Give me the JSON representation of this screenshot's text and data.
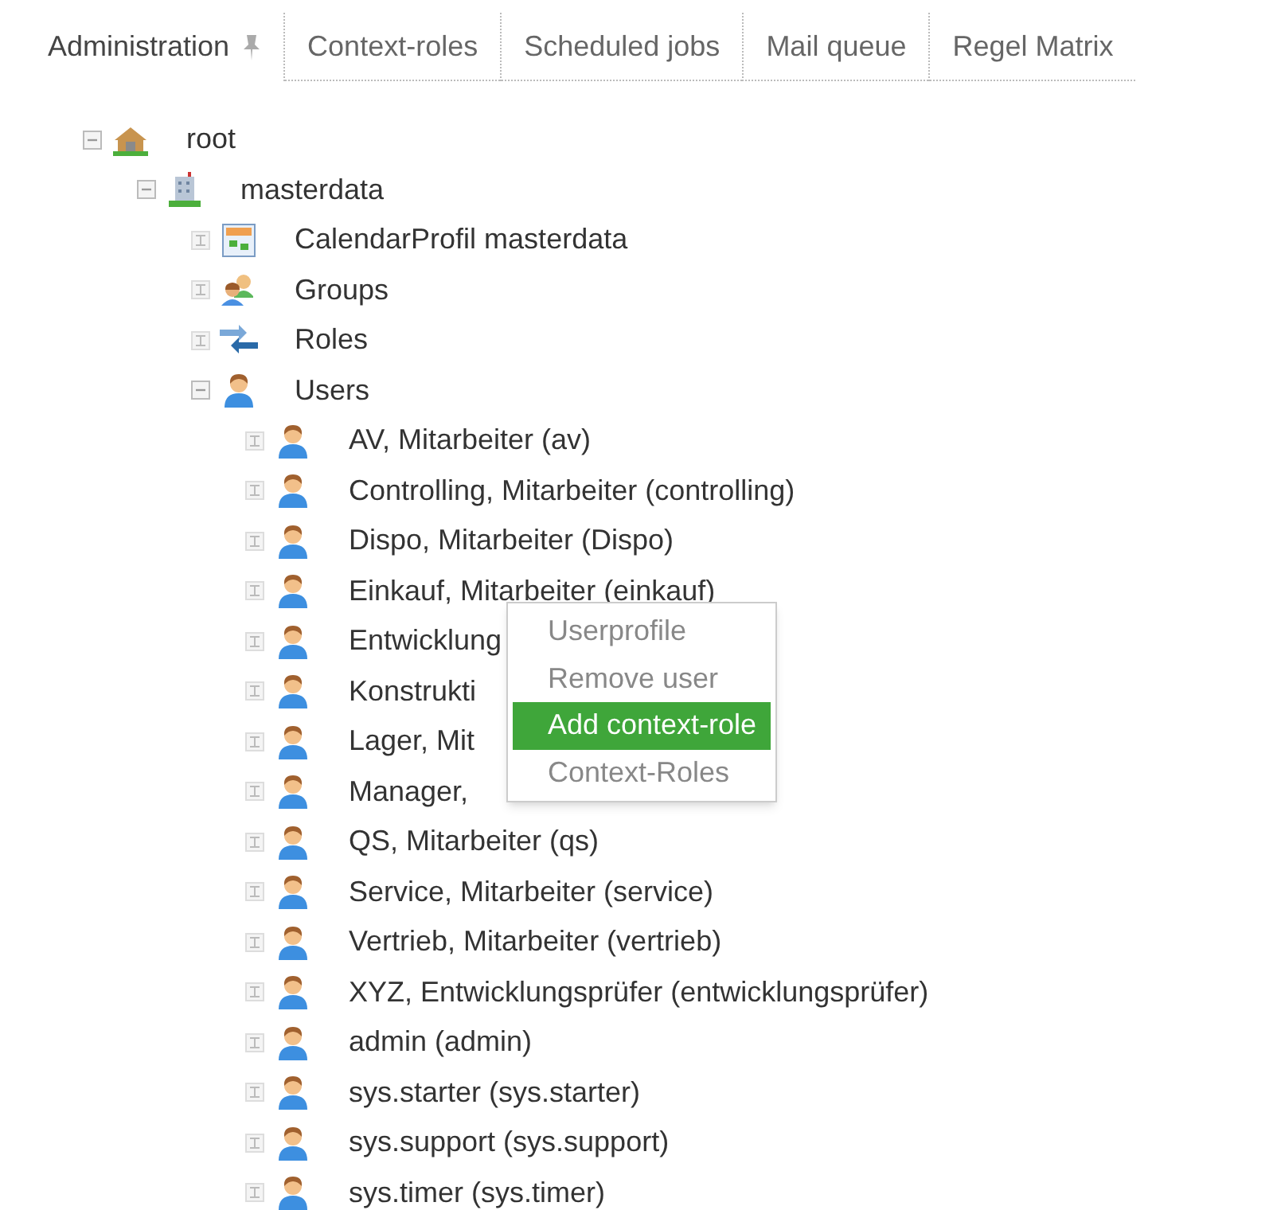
{
  "tabs": [
    {
      "label": "Administration",
      "selected": true,
      "pinned": true
    },
    {
      "label": "Context-roles",
      "selected": false,
      "pinned": false
    },
    {
      "label": "Scheduled jobs",
      "selected": false,
      "pinned": false
    },
    {
      "label": "Mail queue",
      "selected": false,
      "pinned": false
    },
    {
      "label": "Regel Matrix",
      "selected": false,
      "pinned": false
    }
  ],
  "tree": [
    {
      "label": "root",
      "kind": "home",
      "expanded": true,
      "children": [
        {
          "label": "masterdata",
          "kind": "building",
          "expanded": true,
          "children": [
            {
              "label": "CalendarProfil masterdata",
              "kind": "calendar",
              "expanded": false
            },
            {
              "label": "Groups",
              "kind": "group",
              "expanded": false
            },
            {
              "label": "Roles",
              "kind": "roles",
              "expanded": false
            },
            {
              "label": "Users",
              "kind": "user",
              "expanded": true,
              "children": [
                {
                  "label": "AV, Mitarbeiter (av)",
                  "kind": "user",
                  "expanded": false
                },
                {
                  "label": "Controlling, Mitarbeiter (controlling)",
                  "kind": "user",
                  "expanded": false
                },
                {
                  "label": "Dispo, Mitarbeiter (Dispo)",
                  "kind": "user",
                  "expanded": false
                },
                {
                  "label": "Einkauf, Mitarbeiter (einkauf)",
                  "kind": "user",
                  "expanded": false
                },
                {
                  "label": "Entwicklung",
                  "kind": "user",
                  "expanded": false
                },
                {
                  "label": "Konstrukti",
                  "kind": "user",
                  "expanded": false
                },
                {
                  "label": "Lager, Mit",
                  "kind": "user",
                  "expanded": false
                },
                {
                  "label": "Manager,",
                  "kind": "user",
                  "expanded": false
                },
                {
                  "label": "QS, Mitarbeiter (qs)",
                  "kind": "user",
                  "expanded": false
                },
                {
                  "label": "Service, Mitarbeiter (service)",
                  "kind": "user",
                  "expanded": false
                },
                {
                  "label": "Vertrieb, Mitarbeiter (vertrieb)",
                  "kind": "user",
                  "expanded": false
                },
                {
                  "label": "XYZ, Entwicklungsprüfer (entwicklungsprüfer)",
                  "kind": "user",
                  "expanded": false
                },
                {
                  "label": "admin (admin)",
                  "kind": "user",
                  "expanded": false
                },
                {
                  "label": "sys.starter (sys.starter)",
                  "kind": "user",
                  "expanded": false
                },
                {
                  "label": "sys.support (sys.support)",
                  "kind": "user",
                  "expanded": false
                },
                {
                  "label": "sys.timer (sys.timer)",
                  "kind": "user",
                  "expanded": false
                }
              ]
            }
          ]
        }
      ]
    }
  ],
  "context_menu": [
    {
      "label": "Userprofile",
      "selected": false
    },
    {
      "label": "Remove user",
      "selected": false
    },
    {
      "label": "Add context-role",
      "selected": true
    },
    {
      "label": "Context-Roles",
      "selected": false
    }
  ]
}
